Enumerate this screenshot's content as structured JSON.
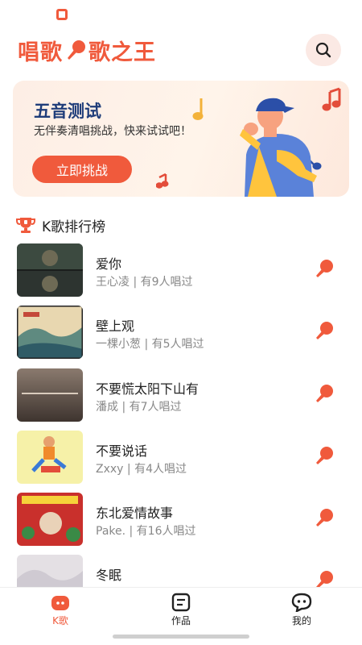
{
  "app": {
    "logo_text_left": "唱歌",
    "logo_text_right": "歌之王",
    "accent_color": "#f05a3c"
  },
  "header": {
    "search_icon": "search-icon"
  },
  "banner": {
    "title": "五音测试",
    "subtitle": "无伴奏清唱挑战，快来试试吧！",
    "button_label": "立即挑战"
  },
  "ranking": {
    "title": "K歌排行榜",
    "songs": [
      {
        "title": "爱你",
        "meta": "王心凌 | 有9人唱过"
      },
      {
        "title": "壁上观",
        "meta": "一棵小葱 | 有5人唱过"
      },
      {
        "title": "不要慌太阳下山有",
        "meta": "潘成 | 有7人唱过"
      },
      {
        "title": "不要说话",
        "meta": "Zxxy | 有4人唱过"
      },
      {
        "title": "东北爱情故事",
        "meta": "Pake. | 有16人唱过"
      },
      {
        "title": "冬眠",
        "meta": ""
      }
    ]
  },
  "bottom_nav": {
    "items": [
      {
        "label": "K歌",
        "icon": "karaoke-icon",
        "active": true
      },
      {
        "label": "作品",
        "icon": "works-icon",
        "active": false
      },
      {
        "label": "我的",
        "icon": "profile-chat-icon",
        "active": false
      }
    ]
  }
}
